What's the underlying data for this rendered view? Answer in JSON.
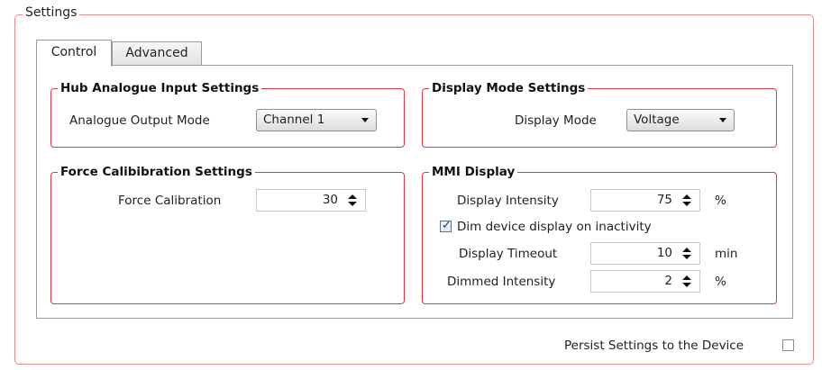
{
  "settings_title": "Settings",
  "tabs": [
    {
      "label": "Control",
      "active": true
    },
    {
      "label": "Advanced",
      "active": false
    }
  ],
  "hub_analogue": {
    "title": "Hub Analogue Input Settings",
    "output_mode_label": "Analogue Output Mode",
    "output_mode_value": "Channel 1"
  },
  "display_mode": {
    "title": "Display Mode Settings",
    "mode_label": "Display Mode",
    "mode_value": "Voltage"
  },
  "force_calibration": {
    "title": "Force Calibibration Settings",
    "label": "Force Calibration",
    "value": "30"
  },
  "mmi_display": {
    "title": "MMI Display",
    "intensity_label": "Display Intensity",
    "intensity_value": "75",
    "intensity_unit": "%",
    "dim_label": "Dim device display on inactivity",
    "dim_checked": true,
    "timeout_label": "Display Timeout",
    "timeout_value": "10",
    "timeout_unit": "min",
    "dimmed_label": "Dimmed Intensity",
    "dimmed_value": "2",
    "dimmed_unit": "%"
  },
  "persist": {
    "label": "Persist Settings to the Device",
    "checked": false
  },
  "colors": {
    "group_border": "#d33d48",
    "outer_border": "#e88b8b"
  }
}
